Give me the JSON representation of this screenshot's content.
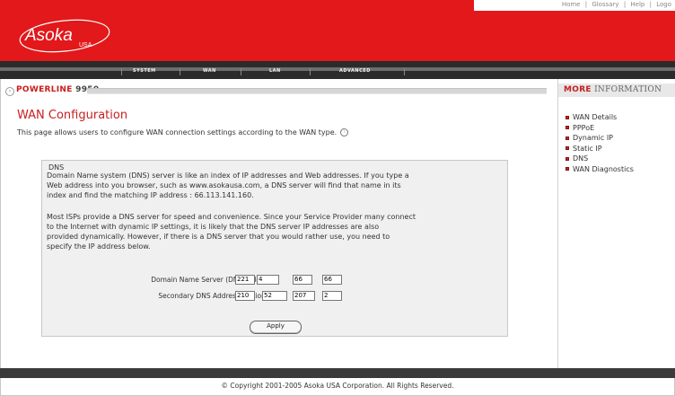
{
  "top_links": [
    "Home",
    "|",
    "Glossary",
    "|",
    "Help",
    "|",
    "Logo"
  ],
  "logo": {
    "text": "Asoka",
    "sub": "USA"
  },
  "nav": [
    "SYSTEM",
    "WAN",
    "LAN",
    "ADVANCED"
  ],
  "product": {
    "prefix": "POWERLINE",
    "model": "9950"
  },
  "more_info": {
    "title_accent": "MORE",
    "title_rest": "INFORMATION",
    "items": [
      "WAN Details",
      "PPPoE",
      "Dynamic IP",
      "Static IP",
      "DNS",
      "WAN Diagnostics"
    ]
  },
  "page": {
    "title": "WAN Configuration",
    "description": "This page allows users to configure WAN connection settings according to the WAN type."
  },
  "dns": {
    "legend": "DNS",
    "para1": [
      "Domain Name system (DNS) server is like an index of IP addresses and Web addresses. If you type a",
      "Web address into you browser, such as www.asokausa.com, a DNS server will find that name in its",
      "index and find the matching IP address : 66.113.141.160."
    ],
    "para2": [
      "Most ISPs provide a DNS server for speed and convenience. Since your Service Provider many connect",
      "to the Internet with dynamic IP settings, it is likely that the DNS server IP addresses are also",
      "provided dynamically. However, if there is a DNS server that you would rather use, you need to",
      "specify the IP address below."
    ],
    "primary_label": "Domain Name Server (DNS) Address:",
    "primary": [
      "221",
      "4",
      "66",
      "66"
    ],
    "secondary_label": "Secondary DNS Address (optional):",
    "secondary": [
      "210",
      "52",
      "207",
      "2"
    ],
    "apply_label": "Apply"
  },
  "copyright": "© Copyright 2001-2005   Asoka USA Corporation. All Rights Reserved."
}
